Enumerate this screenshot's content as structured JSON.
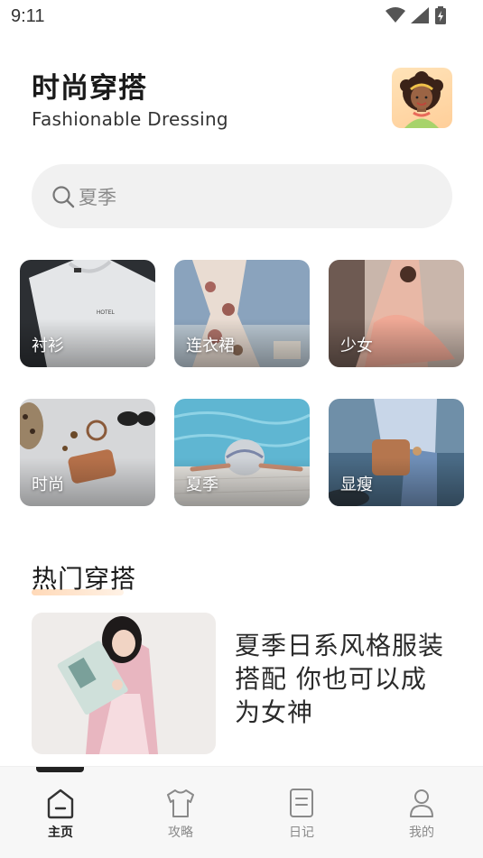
{
  "status_bar": {
    "time": "9:11"
  },
  "header": {
    "title": "时尚穿搭",
    "subtitle": "Fashionable Dressing",
    "avatar_icon": "avatar-woman"
  },
  "search": {
    "placeholder": "夏季"
  },
  "categories": [
    {
      "label": "衬衫"
    },
    {
      "label": "连衣裙"
    },
    {
      "label": "少女"
    },
    {
      "label": "时尚"
    },
    {
      "label": "夏季"
    },
    {
      "label": "显瘦"
    }
  ],
  "hot_section": {
    "title": "热门穿搭",
    "article": {
      "title": "夏季日系风格服装搭配 你也可以成为女神"
    }
  },
  "bottom_nav": {
    "items": [
      {
        "label": "主页",
        "icon": "home-icon",
        "active": true
      },
      {
        "label": "攻略",
        "icon": "shirt-icon",
        "active": false
      },
      {
        "label": "日记",
        "icon": "notebook-icon",
        "active": false
      },
      {
        "label": "我的",
        "icon": "person-icon",
        "active": false
      }
    ]
  },
  "colors": {
    "accent_underline": "#ffd9b8",
    "search_bg": "#f1f1f1",
    "nav_bg": "#f7f7f7"
  }
}
